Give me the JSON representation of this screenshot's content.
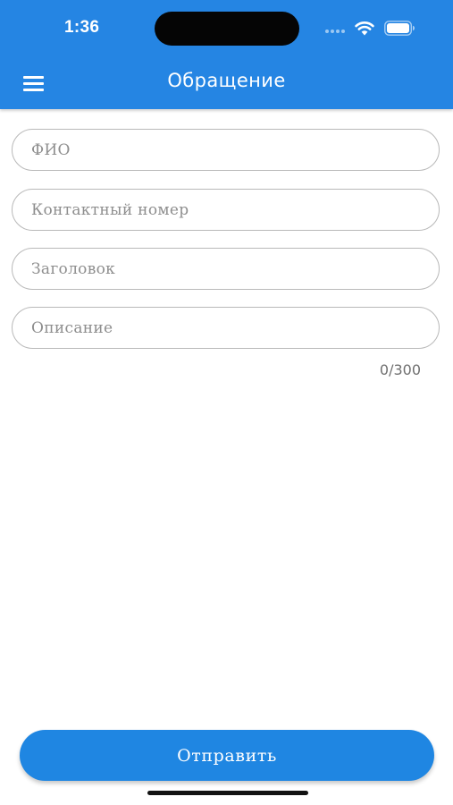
{
  "status_bar": {
    "time": "1:36",
    "icons": [
      "cellular-signal-icon",
      "wifi-icon",
      "battery-icon"
    ]
  },
  "header": {
    "title": "Обращение",
    "menu_icon": "hamburger-menu-icon"
  },
  "form": {
    "full_name_placeholder": "ФИО",
    "full_name_value": "",
    "contact_number_placeholder": "Контактный номер",
    "contact_number_value": "",
    "subject_placeholder": "Заголовок",
    "subject_value": "",
    "description_placeholder": "Описание",
    "description_value": "",
    "description_counter": "0/300"
  },
  "actions": {
    "submit_label": "Отправить"
  },
  "colors": {
    "accent": "#2585e3",
    "button": "#1f86e2",
    "field_border": "#b9b9b9",
    "placeholder": "#8e8e8e"
  }
}
